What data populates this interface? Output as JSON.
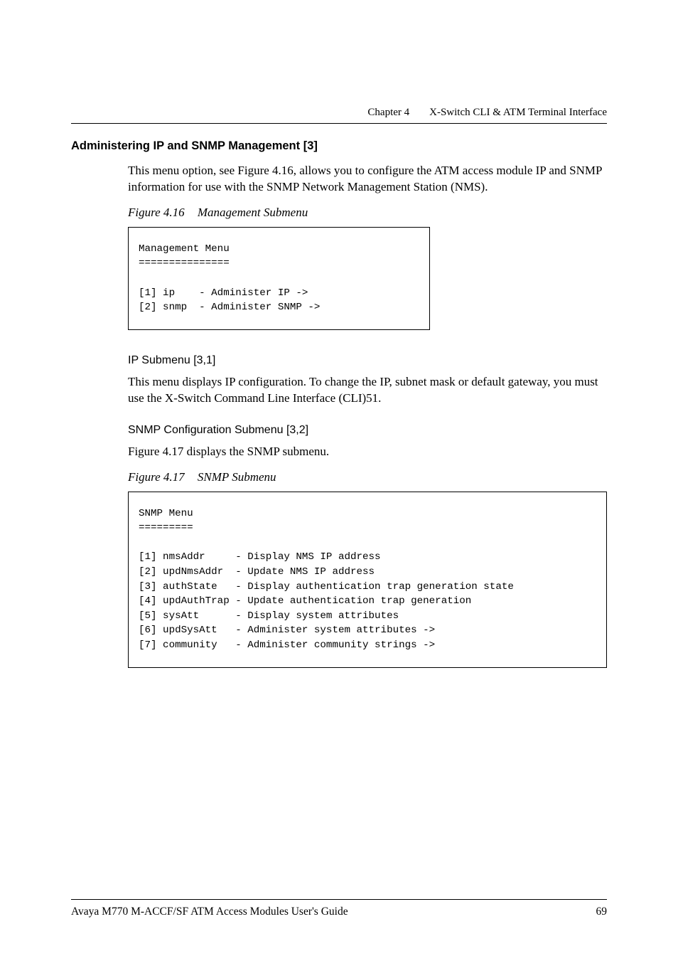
{
  "header": {
    "chapter": "Chapter 4",
    "title": "X-Switch CLI & ATM Terminal Interface"
  },
  "section": {
    "title": "Administering IP and SNMP Management [3]",
    "intro": "This menu option, see Figure 4.16, allows you to configure the ATM access module IP and SNMP information for use with the SNMP Network Management Station (NMS)."
  },
  "figure16": {
    "label": "Figure 4.16",
    "caption": "Management Submenu",
    "code": "Management Menu\n===============\n\n[1] ip    - Administer IP ->\n[2] snmp  - Administer SNMP ->"
  },
  "ip_sub": {
    "heading": "IP Submenu [3,1]",
    "text": "This menu displays IP configuration. To change the IP, subnet mask or default gateway, you must use the X-Switch Command Line Interface (CLI)51."
  },
  "snmp_sub": {
    "heading": "SNMP Configuration Submenu [3,2]",
    "text": "Figure 4.17 displays the SNMP submenu."
  },
  "figure17": {
    "label": "Figure 4.17",
    "caption": "SNMP Submenu",
    "code": "SNMP Menu\n=========\n\n[1] nmsAddr     - Display NMS IP address\n[2] updNmsAddr  - Update NMS IP address\n[3] authState   - Display authentication trap generation state\n[4] updAuthTrap - Update authentication trap generation\n[5] sysAtt      - Display system attributes\n[6] updSysAtt   - Administer system attributes ->\n[7] community   - Administer community strings ->"
  },
  "footer": {
    "left": "Avaya M770 M-ACCF/SF ATM Access Modules User's Guide",
    "right": "69"
  }
}
